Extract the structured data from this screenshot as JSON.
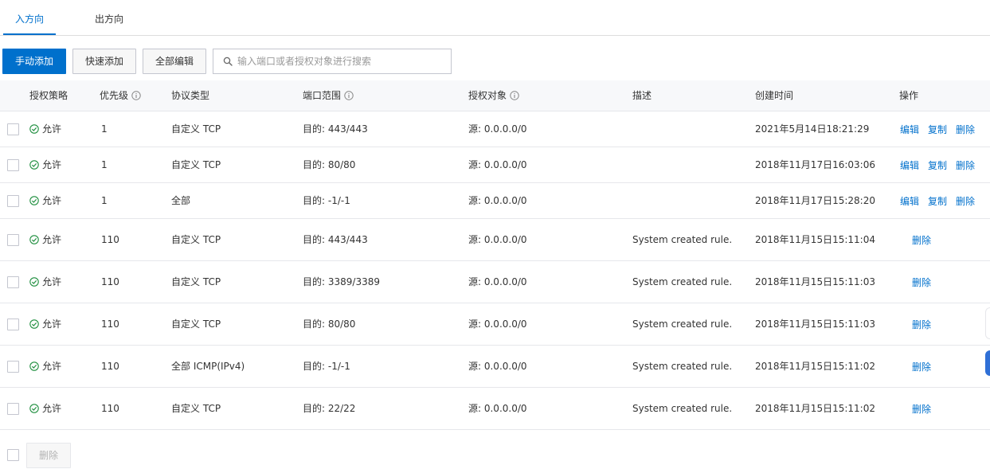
{
  "tabs": {
    "inbound": "入方向",
    "outbound": "出方向"
  },
  "toolbar": {
    "manual_add": "手动添加",
    "quick_add": "快速添加",
    "edit_all": "全部编辑",
    "search_placeholder": "输入端口或者授权对象进行搜索",
    "search_value": ""
  },
  "table": {
    "headers": {
      "policy": "授权策略",
      "priority": "优先级",
      "protocol": "协议类型",
      "port_range": "端口范围",
      "auth_object": "授权对象",
      "description": "描述",
      "created": "创建时间",
      "actions": "操作"
    },
    "rows": [
      {
        "policy": "允许",
        "priority": "1",
        "protocol": "自定义 TCP",
        "port": "目的: 443/443",
        "source": "源: 0.0.0.0/0",
        "description": "",
        "created": "2021年5月14日18:21:29",
        "actions": [
          "编辑",
          "复制",
          "删除"
        ]
      },
      {
        "policy": "允许",
        "priority": "1",
        "protocol": "自定义 TCP",
        "port": "目的: 80/80",
        "source": "源: 0.0.0.0/0",
        "description": "",
        "created": "2018年11月17日16:03:06",
        "actions": [
          "编辑",
          "复制",
          "删除"
        ]
      },
      {
        "policy": "允许",
        "priority": "1",
        "protocol": "全部",
        "port": "目的: -1/-1",
        "source": "源: 0.0.0.0/0",
        "description": "",
        "created": "2018年11月17日15:28:20",
        "actions": [
          "编辑",
          "复制",
          "删除"
        ]
      },
      {
        "policy": "允许",
        "priority": "110",
        "protocol": "自定义 TCP",
        "port": "目的: 443/443",
        "source": "源: 0.0.0.0/0",
        "description": "System created rule.",
        "created": "2018年11月15日15:11:04",
        "actions": [
          "删除"
        ]
      },
      {
        "policy": "允许",
        "priority": "110",
        "protocol": "自定义 TCP",
        "port": "目的: 3389/3389",
        "source": "源: 0.0.0.0/0",
        "description": "System created rule.",
        "created": "2018年11月15日15:11:03",
        "actions": [
          "删除"
        ]
      },
      {
        "policy": "允许",
        "priority": "110",
        "protocol": "自定义 TCP",
        "port": "目的: 80/80",
        "source": "源: 0.0.0.0/0",
        "description": "System created rule.",
        "created": "2018年11月15日15:11:03",
        "actions": [
          "删除"
        ]
      },
      {
        "policy": "允许",
        "priority": "110",
        "protocol": "全部 ICMP(IPv4)",
        "port": "目的: -1/-1",
        "source": "源: 0.0.0.0/0",
        "description": "System created rule.",
        "created": "2018年11月15日15:11:02",
        "actions": [
          "删除"
        ]
      },
      {
        "policy": "允许",
        "priority": "110",
        "protocol": "自定义 TCP",
        "port": "目的: 22/22",
        "source": "源: 0.0.0.0/0",
        "description": "System created rule.",
        "created": "2018年11月15日15:11:02",
        "actions": [
          "删除"
        ]
      }
    ]
  },
  "footer": {
    "delete": "删除"
  },
  "icons": {
    "allow": "check-circle-icon",
    "info": "info-circle-icon",
    "search": "search-icon"
  },
  "colors": {
    "accent": "#0070cc",
    "allow": "#1e8e3e"
  }
}
